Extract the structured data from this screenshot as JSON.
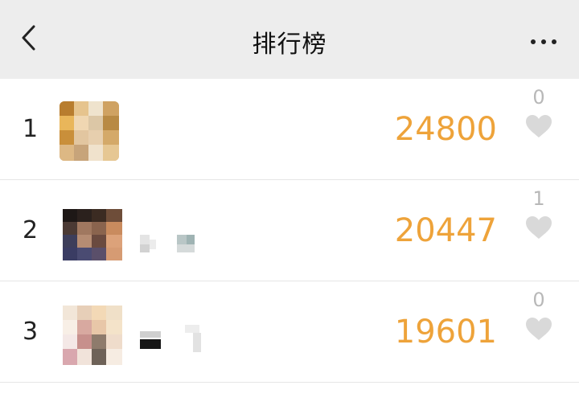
{
  "nav": {
    "title": "排行榜",
    "back_icon": "chevron-left-icon",
    "more_icon": "more-dots-icon"
  },
  "colors": {
    "nav_bg": "#ededed",
    "steps": "#eea33a",
    "like_count": "#b8b8b8",
    "heart": "#d9d9d9"
  },
  "rows": [
    {
      "rank": "1",
      "steps": "24800",
      "likes": "0"
    },
    {
      "rank": "2",
      "steps": "20447",
      "likes": "1"
    },
    {
      "rank": "3",
      "steps": "19601",
      "likes": "0"
    }
  ]
}
